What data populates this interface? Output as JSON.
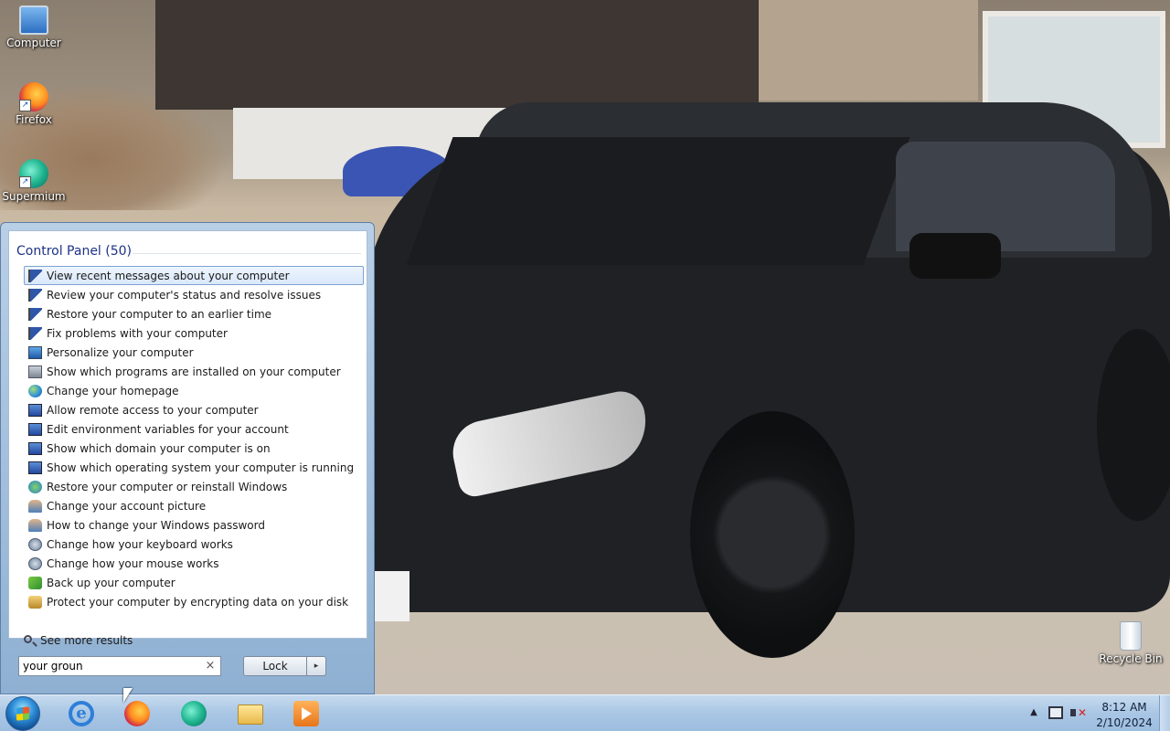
{
  "desktop": {
    "icons": [
      {
        "label": "Computer",
        "icon": "computer-icon"
      },
      {
        "label": "Firefox",
        "icon": "firefox-icon"
      },
      {
        "label": "Supermium",
        "icon": "supermium-icon"
      },
      {
        "label": "Recycle Bin",
        "icon": "recycle-bin-icon"
      }
    ]
  },
  "start_menu": {
    "group_header": "Control Panel (50)",
    "results": [
      {
        "label": "View recent messages about your computer",
        "icon": "action-center-flag-icon"
      },
      {
        "label": "Review your computer's status and resolve issues",
        "icon": "action-center-flag-icon"
      },
      {
        "label": "Restore your computer to an earlier time",
        "icon": "action-center-flag-icon"
      },
      {
        "label": "Fix problems with your computer",
        "icon": "action-center-flag-icon"
      },
      {
        "label": "Personalize your computer",
        "icon": "personalization-monitor-icon"
      },
      {
        "label": "Show which programs are installed on your computer",
        "icon": "programs-icon"
      },
      {
        "label": "Change your homepage",
        "icon": "internet-options-globe-icon"
      },
      {
        "label": "Allow remote access to your computer",
        "icon": "system-icon"
      },
      {
        "label": "Edit environment variables for your account",
        "icon": "system-icon"
      },
      {
        "label": "Show which domain your computer is on",
        "icon": "system-icon"
      },
      {
        "label": "Show which operating system your computer is running",
        "icon": "system-icon"
      },
      {
        "label": "Restore your computer or reinstall Windows",
        "icon": "recovery-icon"
      },
      {
        "label": "Change your account picture",
        "icon": "user-accounts-icon"
      },
      {
        "label": "How to change your Windows password",
        "icon": "user-accounts-icon"
      },
      {
        "label": "Change how your keyboard works",
        "icon": "ease-of-access-icon"
      },
      {
        "label": "Change how your mouse works",
        "icon": "ease-of-access-icon"
      },
      {
        "label": "Back up your computer",
        "icon": "backup-icon"
      },
      {
        "label": "Protect your computer by encrypting data on your disk",
        "icon": "bitlocker-icon"
      }
    ],
    "selected_index": 0,
    "see_more": "See more results",
    "search": {
      "value": "your groun",
      "clear_symbol": "×"
    },
    "power_button": {
      "label": "Lock",
      "arrow": "▸"
    }
  },
  "taskbar": {
    "pinned": [
      {
        "name": "internet-explorer",
        "icon": "internet-explorer-icon"
      },
      {
        "name": "firefox",
        "icon": "firefox-icon"
      },
      {
        "name": "supermium",
        "icon": "supermium-icon"
      },
      {
        "name": "windows-explorer",
        "icon": "folder-icon"
      },
      {
        "name": "media-player",
        "icon": "media-player-icon"
      }
    ],
    "tray": {
      "chevron": "▲",
      "volume_muted_symbol": "✕"
    },
    "clock": {
      "time": "8:12 AM",
      "date": "2/10/2024"
    }
  },
  "colors": {
    "accent": "#1e3287",
    "selection_border": "#7da2ce",
    "taskbar": "#a9c6e4"
  }
}
